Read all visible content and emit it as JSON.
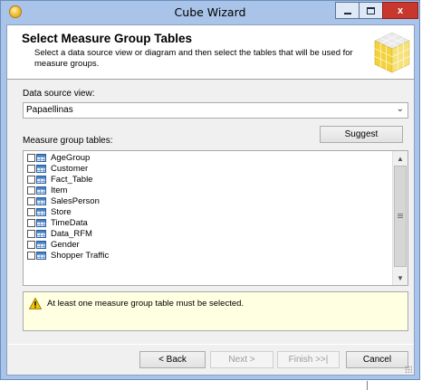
{
  "window": {
    "title": "Cube Wizard",
    "close_glyph": "x"
  },
  "header": {
    "title": "Select Measure Group Tables",
    "description": "Select a data source view or diagram and then select the tables that will be used for measure groups."
  },
  "data_source_view": {
    "label": "Data source view:",
    "selected": "Papaellinas"
  },
  "measure_group": {
    "label": "Measure group tables:",
    "suggest_label": "Suggest",
    "tables": [
      {
        "name": "AgeGroup",
        "checked": false
      },
      {
        "name": "Customer",
        "checked": false
      },
      {
        "name": "Fact_Table",
        "checked": false
      },
      {
        "name": "Item",
        "checked": false
      },
      {
        "name": "SalesPerson",
        "checked": false
      },
      {
        "name": "Store",
        "checked": false
      },
      {
        "name": "TimeData",
        "checked": false
      },
      {
        "name": "Data_RFM",
        "checked": false
      },
      {
        "name": "Gender",
        "checked": false
      },
      {
        "name": "Shopper Traffic",
        "checked": false
      }
    ]
  },
  "warning": {
    "message": "At least one measure group table must be selected."
  },
  "footer": {
    "back_label": "< Back",
    "next_label": "Next >",
    "finish_label": "Finish >>|",
    "cancel_label": "Cancel"
  },
  "icons": {
    "app": "cube-wizard-icon",
    "header": "cube-icon",
    "warning": "warning-icon",
    "table": "table-icon"
  },
  "colors": {
    "titlebar": "#a9c4e8",
    "close_button": "#c7372d",
    "warning_background": "#ffffe1"
  }
}
